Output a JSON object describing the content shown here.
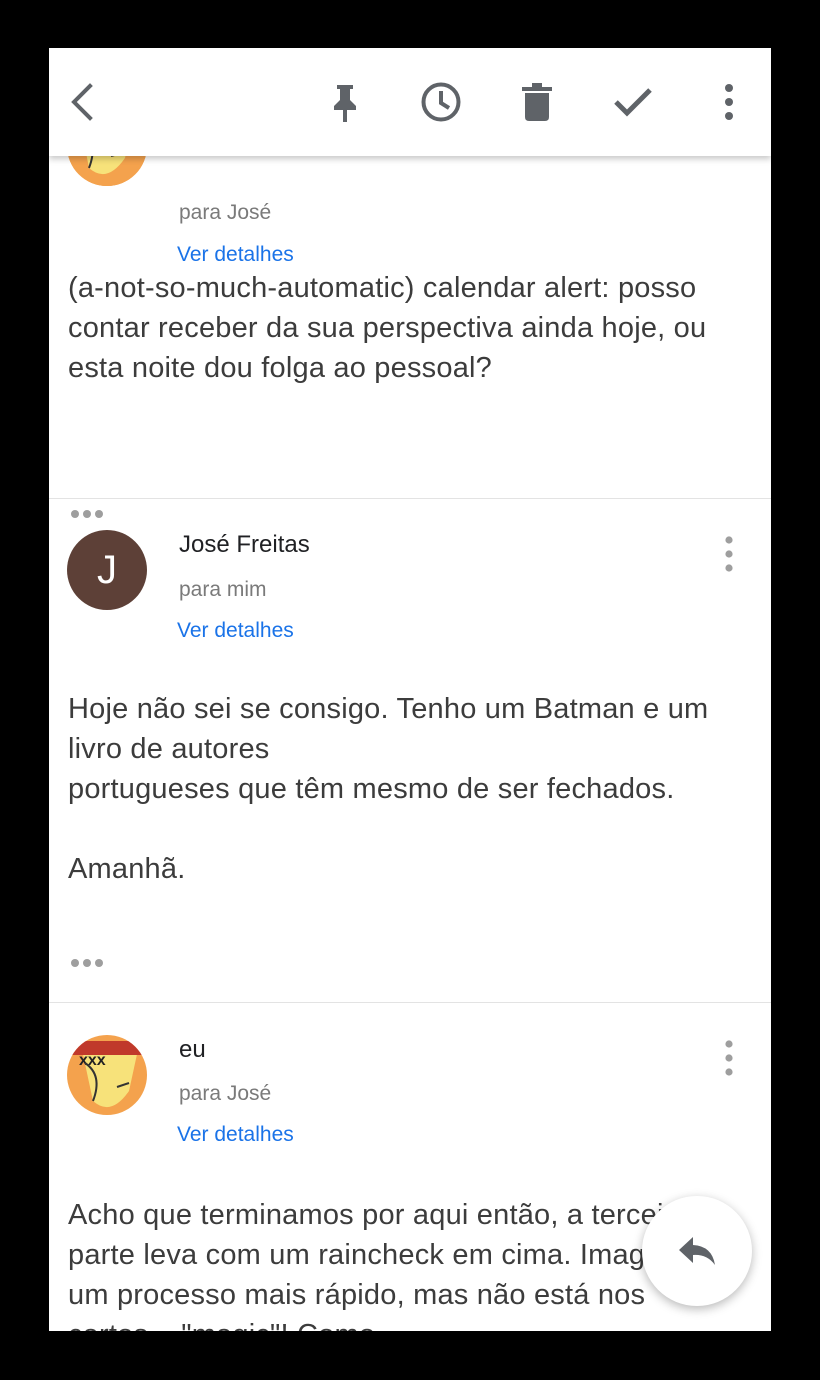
{
  "toolbar": {
    "icons": [
      "back-arrow-icon",
      "pin-icon",
      "clock-icon",
      "trash-icon",
      "check-icon",
      "more-vert-icon"
    ]
  },
  "messages": [
    {
      "recipient": "para José",
      "details_link": "Ver detalhes",
      "body": "(a-not-so-much-automatic) calendar alert: posso contar receber da sua perspectiva ainda hoje, ou esta noite dou folga ao pessoal?"
    },
    {
      "sender": "José Freitas",
      "avatar_letter": "J",
      "recipient": "para mim",
      "details_link": "Ver detalhes",
      "body": "Hoje não sei se consigo. Tenho um Batman e um livro de autores\nportugueses que têm mesmo de ser fechados.\n\nAmanhã."
    },
    {
      "sender": "eu",
      "recipient": "para José",
      "details_link": "Ver detalhes",
      "body": "Acho que terminamos por aqui então, a terceira parte leva com um raincheck em cima. Imaginava um processo mais rápido, mas não está nos cartos... \"magic\"! Como"
    }
  ],
  "colors": {
    "link": "#1a73e8",
    "avatar_j": "#5d4037",
    "icon": "#5f6368"
  }
}
